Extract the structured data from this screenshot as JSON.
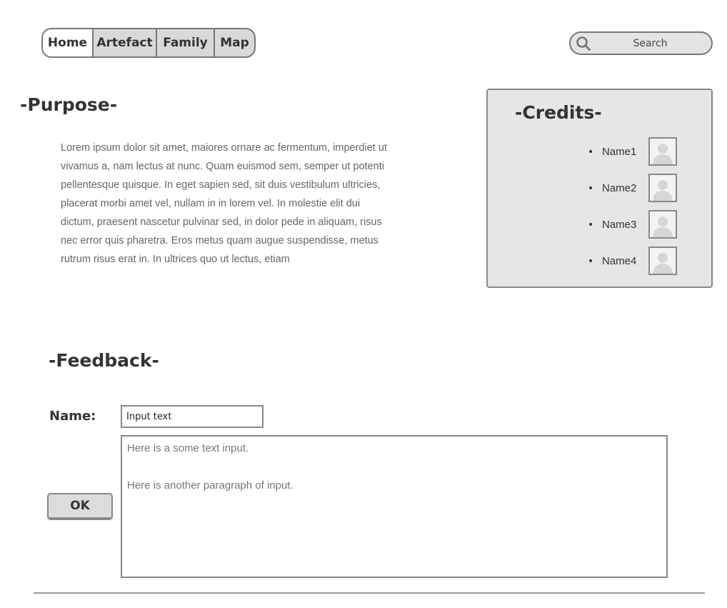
{
  "nav": {
    "tabs": [
      {
        "label": "Home",
        "active": true
      },
      {
        "label": "Artefact",
        "active": false
      },
      {
        "label": "Family",
        "active": false
      },
      {
        "label": "Map",
        "active": false
      }
    ]
  },
  "search": {
    "placeholder": "Search",
    "icon": "search-icon"
  },
  "purpose": {
    "title": "-Purpose-",
    "body": "Lorem ipsum dolor sit amet, maiores ornare ac fermentum, imperdiet ut vivamus a, nam lectus at nunc. Quam euismod sem, semper ut potenti pellentesque quisque. In eget sapien sed, sit duis vestibulum ultricies, placerat morbi amet vel, nullam in in lorem vel. In molestie elit dui dictum, praesent nascetur pulvinar sed, in dolor pede in aliquam, risus nec error quis pharetra. Eros metus quam augue suspendisse, metus rutrum risus erat in.  In ultrices quo ut lectus, etiam"
  },
  "credits": {
    "title": "-Credits-",
    "items": [
      {
        "name": "Name1",
        "icon": "user-avatar-icon"
      },
      {
        "name": "Name2",
        "icon": "user-avatar-icon"
      },
      {
        "name": "Name3",
        "icon": "user-avatar-icon"
      },
      {
        "name": "Name4",
        "icon": "user-avatar-icon"
      }
    ]
  },
  "feedback": {
    "title": "-Feedback-",
    "name_label": "Name:",
    "name_value": "Input text",
    "ok_label": "OK",
    "textarea": {
      "paragraph1": "Here is a some text input.",
      "paragraph2": "Here is another paragraph of input."
    }
  },
  "colors": {
    "tab_bg": "#d9d9d9",
    "active_tab_bg": "#ffffff",
    "panel_bg": "#e6e6e6",
    "border": "#888888",
    "text": "#333333"
  }
}
